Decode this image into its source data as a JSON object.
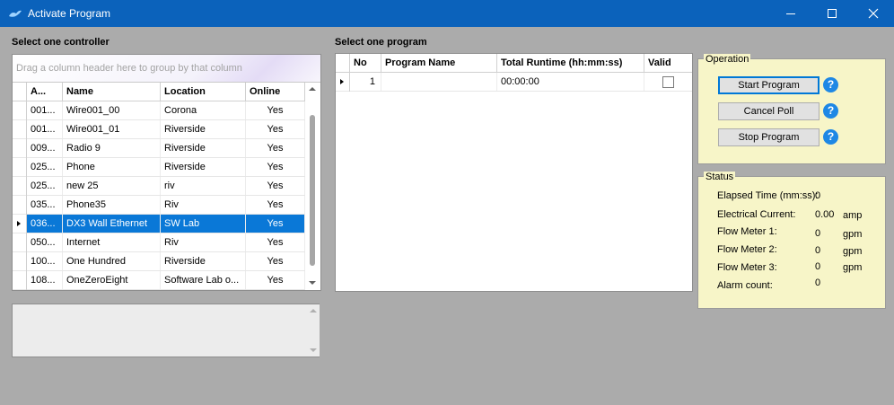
{
  "window": {
    "title": "Activate Program"
  },
  "controllers": {
    "label": "Select one controller",
    "group_hint": "Drag a column header here to group by that column",
    "columns": [
      "A...",
      "Name",
      "Location",
      "Online"
    ],
    "rows": [
      {
        "address": "001...",
        "name": "Wire001_00",
        "location": "Corona",
        "online": "Yes"
      },
      {
        "address": "001...",
        "name": "Wire001_01",
        "location": "Riverside",
        "online": "Yes"
      },
      {
        "address": "009...",
        "name": "Radio 9",
        "location": "Riverside",
        "online": "Yes"
      },
      {
        "address": "025...",
        "name": "Phone",
        "location": "Riverside",
        "online": "Yes"
      },
      {
        "address": "025...",
        "name": "new 25",
        "location": "riv",
        "online": "Yes"
      },
      {
        "address": "035...",
        "name": "Phone35",
        "location": "Riv",
        "online": "Yes"
      },
      {
        "address": "036...",
        "name": "DX3 Wall Ethernet",
        "location": "SW Lab",
        "online": "Yes",
        "selected": true
      },
      {
        "address": "050...",
        "name": "Internet",
        "location": "Riv",
        "online": "Yes"
      },
      {
        "address": "100...",
        "name": "One Hundred",
        "location": "Riverside",
        "online": "Yes"
      },
      {
        "address": "108...",
        "name": "OneZeroEight",
        "location": "Software Lab o...",
        "online": "Yes"
      }
    ]
  },
  "programs": {
    "label": "Select one program",
    "columns": [
      "No",
      "Program Name",
      "Total Runtime (hh:mm:ss)",
      "Valid"
    ],
    "rows": [
      {
        "no": "1",
        "name": "",
        "runtime": "00:00:00",
        "valid": false
      }
    ]
  },
  "operation": {
    "title": "Operation",
    "start_label": "Start Program",
    "cancel_label": "Cancel Poll",
    "stop_label": "Stop Program",
    "help_glyph": "?"
  },
  "status": {
    "title": "Status",
    "elapsed_label": "Elapsed Time (mm:ss):",
    "elapsed_value": "0",
    "current_label": "Electrical Current:",
    "current_value": "0.00",
    "current_unit": "amp",
    "flow1_label": "Flow Meter 1:",
    "flow1_value": "0",
    "flow1_unit": "gpm",
    "flow2_label": "Flow Meter 2:",
    "flow2_value": "0",
    "flow2_unit": "gpm",
    "flow3_label": "Flow Meter 3:",
    "flow3_value": "0",
    "flow3_unit": "gpm",
    "alarm_label": "Alarm count:",
    "alarm_value": "0"
  },
  "colors": {
    "titlebar": "#0b62bb",
    "selection": "#0a78d7",
    "panel": "#f7f5c8",
    "background": "#ababab"
  }
}
